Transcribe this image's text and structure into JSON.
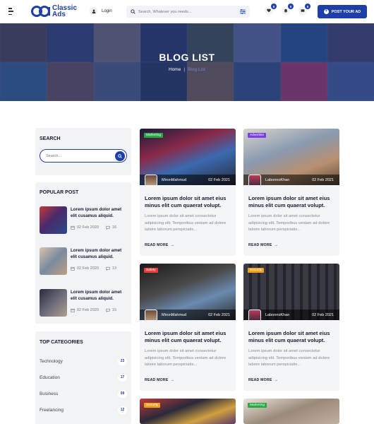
{
  "header": {
    "logo_line1": "Classic",
    "logo_line2": "Ads",
    "login_label": "Login",
    "search_placeholder": "Search, Whatever you needs...",
    "favorites_count": "0",
    "notifications_count": "0",
    "messages_count": "0",
    "post_ad_label": "POST YOUR AD"
  },
  "hero": {
    "title": "BLOG LIST",
    "breadcrumb_home": "Home",
    "breadcrumb_current": "Blog List"
  },
  "sidebar": {
    "search_title": "SEARCH",
    "search_placeholder": "Search...",
    "popular_title": "POPULAR POST",
    "popular": [
      {
        "title": "Lorem ipsum dolor amet elit cusamus aliquid.",
        "date": "02 Feb 2020",
        "comments": "16"
      },
      {
        "title": "Lorem ipsum dolor amet elit cusamus aliquid.",
        "date": "02 Feb 2020",
        "comments": "13"
      },
      {
        "title": "Lorem ipsum dolor amet elit cusamus aliquid.",
        "date": "02 Feb 2020",
        "comments": "15"
      }
    ],
    "categories_title": "TOP CATEGORIES",
    "categories": [
      {
        "name": "Technology",
        "count": "23"
      },
      {
        "name": "Education",
        "count": "17"
      },
      {
        "name": "Business",
        "count": "09"
      },
      {
        "name": "Freelancing",
        "count": "12"
      }
    ]
  },
  "posts": [
    {
      "tag": "Marketing",
      "author": "MironMahmud",
      "date": "02 Feb 2021",
      "title": "Lorem ipsum dolor sit amet eius minus elit cum quaerat volupt.",
      "excerpt": "Lorem ipsum dolor sit amet consectetur adipisicing elit. Temporibus veniam ad dolore labore laborum perspiciatis...",
      "more": "READ MORE"
    },
    {
      "tag": "Advertise",
      "author": "LabonnoKhan",
      "date": "02 Feb 2021",
      "title": "Lorem ipsum dolor sit amet eius minus elit cum quaerat volupt.",
      "excerpt": "Lorem ipsum dolor sit amet consectetur adipisicing elit. Temporibus veniam ad dolore labore laborum perspiciatis...",
      "more": "READ MORE"
    },
    {
      "tag": "Safety",
      "author": "MironMahmud",
      "date": "02 Feb 2021",
      "title": "Lorem ipsum dolor sit amet eius minus elit cum quaerat volupt.",
      "excerpt": "Lorem ipsum dolor sit amet consectetur adipisicing elit. Temporibus veniam ad dolore labore laborum perspiciatis...",
      "more": "READ MORE"
    },
    {
      "tag": "Security",
      "author": "LabonnoKhan",
      "date": "02 Feb 2021",
      "title": "Lorem ipsum dolor sit amet eius minus elit cum quaerat volupt.",
      "excerpt": "Lorem ipsum dolor sit amet consectetur adipisicing elit. Temporibus veniam ad dolore labore laborum perspiciatis...",
      "more": "READ MORE"
    },
    {
      "tag": "Security",
      "author": "",
      "date": "",
      "title": "",
      "excerpt": "",
      "more": ""
    },
    {
      "tag": "Marketing",
      "author": "",
      "date": "",
      "title": "",
      "excerpt": "",
      "more": ""
    }
  ],
  "colors": {
    "brand": "#1e3fa8",
    "tag_marketing": "#28a745",
    "tag_advertise": "#7b3fe4",
    "tag_safety": "#e5413c",
    "tag_security": "#f0a020"
  }
}
